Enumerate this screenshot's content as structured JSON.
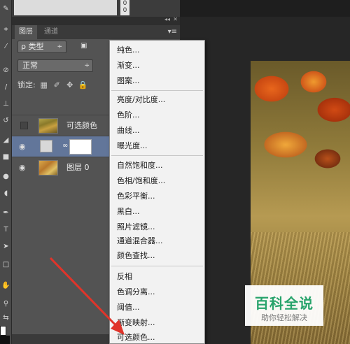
{
  "top_ruler": {
    "digits": "0\n0"
  },
  "layers_panel": {
    "collapse_glyph": "◂◂",
    "close_glyph": "✕",
    "menu_glyph": "▾≡",
    "tabs": [
      {
        "label": "图层"
      },
      {
        "label": "通道"
      }
    ],
    "filter": {
      "label": "ρ 类型",
      "arrow": "÷"
    },
    "blend_mode": {
      "value": "正常",
      "arrow": "÷"
    },
    "lock": {
      "label": "锁定:"
    },
    "layers": [
      {
        "name": "可选颜色"
      },
      {
        "name": ""
      },
      {
        "name": "图层 0"
      }
    ]
  },
  "menu": {
    "items": [
      {
        "label": "纯色..."
      },
      {
        "label": "渐变..."
      },
      {
        "label": "图案..."
      },
      {
        "label": "亮度/对比度..."
      },
      {
        "label": "色阶..."
      },
      {
        "label": "曲线..."
      },
      {
        "label": "曝光度..."
      },
      {
        "label": "自然饱和度..."
      },
      {
        "label": "色相/饱和度..."
      },
      {
        "label": "色彩平衡..."
      },
      {
        "label": "黑白..."
      },
      {
        "label": "照片滤镜..."
      },
      {
        "label": "通道混合器..."
      },
      {
        "label": "颜色查找..."
      },
      {
        "label": "反相"
      },
      {
        "label": "色调分离..."
      },
      {
        "label": "阈值..."
      },
      {
        "label": "渐变映射..."
      },
      {
        "label": "可选颜色..."
      }
    ]
  },
  "watermark": {
    "title": "百科全说",
    "subtitle": "助你轻松解决"
  },
  "colors": {
    "selected_layer": "#62769a",
    "menu_bg": "#f2f2f2",
    "arrow": "#e0342a",
    "watermark_green": "#27a36b"
  }
}
